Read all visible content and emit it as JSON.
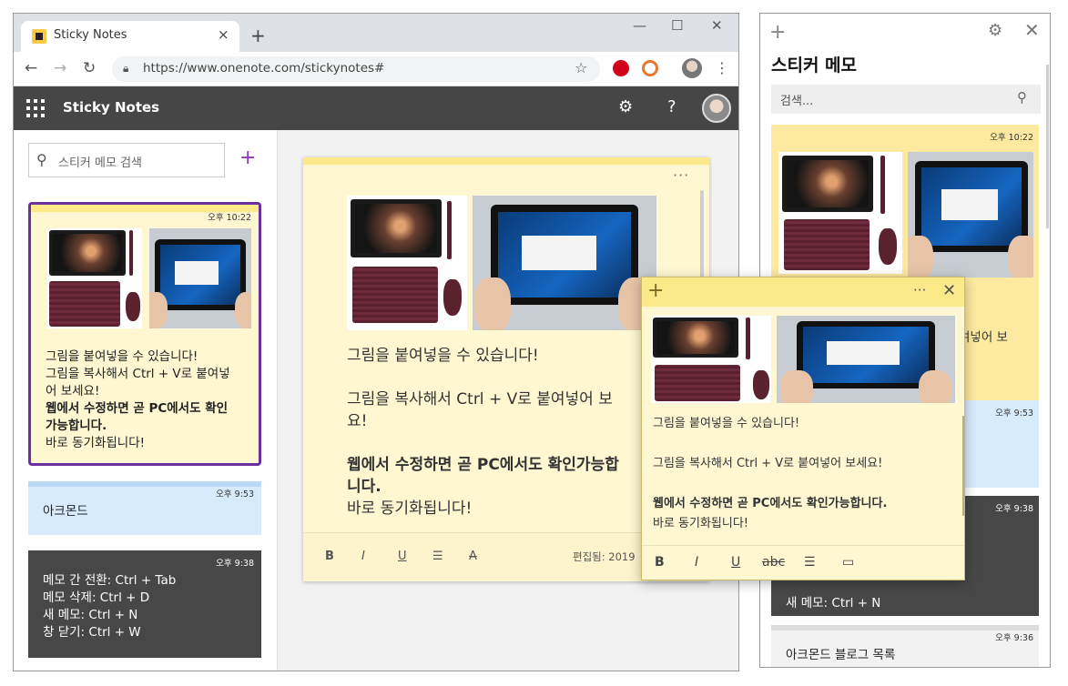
{
  "browser": {
    "tab_title": "Sticky Notes",
    "tab_close": "×",
    "new_tab": "+",
    "url": "https://www.onenote.com/stickynotes#",
    "win_min": "—",
    "win_max": "☐",
    "win_close": "✕"
  },
  "app": {
    "title": "Sticky Notes",
    "search_placeholder": "스티커 메모 검색",
    "add": "+",
    "settings_icon": "gear-icon",
    "help": "?"
  },
  "web_list": [
    {
      "time": "오후 10:22",
      "lines": [
        "그림을 붙여넣을 수 있습니다!",
        "그림을 복사해서 Ctrl + V로 붙여넣",
        "어 보세요!"
      ],
      "bold_lines": [
        "웹에서 수정하면 곧 PC에서도 확인",
        "가능합니다."
      ],
      "tail": "바로 동기화됩니다!"
    },
    {
      "time": "오후 9:53",
      "text": "아크몬드"
    },
    {
      "time": "오후 9:38",
      "lines": [
        "메모 간 전환: Ctrl + Tab",
        "메모 삭제: Ctrl + D",
        "새 메모: Ctrl + N",
        "창 닫기: Ctrl + W"
      ]
    }
  ],
  "web_note": {
    "more": "···",
    "p1": "그림을 붙여넣을 수 있습니다!",
    "p2a": "그림을 복사해서 Ctrl + V로 붙여넣어 보",
    "p2b": "요!",
    "p3a": "웹에서 수정하면 곧 PC에서도 확인가능합",
    "p3b": "니다.",
    "p4": "바로 동기화됩니다!",
    "edited": "편집됨: 2019",
    "toolbar": {
      "bold": "B",
      "italic": "I",
      "underline": "U",
      "list": "☰",
      "format": "A"
    }
  },
  "desk_note": {
    "add": "+",
    "more": "···",
    "close": "✕",
    "p1": "그림을 붙여넣을 수 있습니다!",
    "p2": "그림을 복사해서 Ctrl + V로 붙여넣어 보세요!",
    "p3": "웹에서 수정하면 곧 PC에서도 확인가능합니다.",
    "p4": "바로 동기화됩니다!",
    "toolbar": {
      "bold": "B",
      "italic": "I",
      "underline": "U",
      "strike": "abc",
      "list": "☰",
      "image": "▭"
    }
  },
  "desk_list": {
    "title": "스티커 메모",
    "search_placeholder": "검색...",
    "cards": [
      {
        "time": "오후 10:22",
        "peek": "여넣어 보"
      },
      {
        "time": "오후 9:53"
      },
      {
        "time": "오후 9:38",
        "text": "새 메모: Ctrl + N"
      },
      {
        "time": "오후 9:36",
        "text": "아크몬드 블로그 목록"
      }
    ]
  }
}
